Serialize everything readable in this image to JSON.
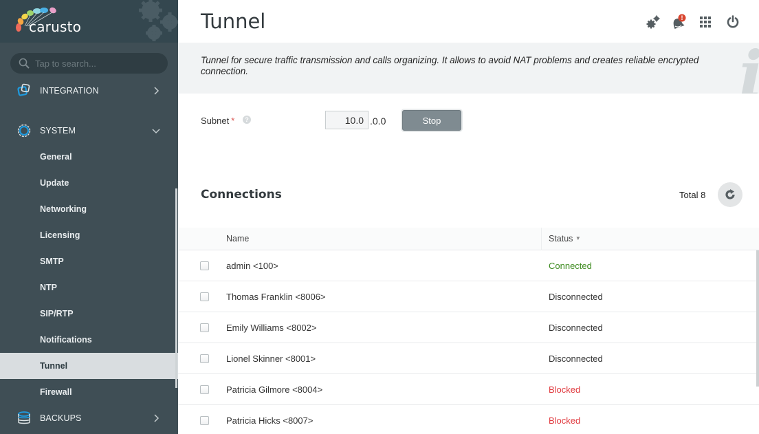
{
  "app": {
    "logo_text": "carusto"
  },
  "search": {
    "placeholder": "Tap to search..."
  },
  "sidebar": {
    "sections": [
      {
        "label": "INTEGRATION",
        "icon": "integration-icon",
        "expanded": false
      },
      {
        "label": "SYSTEM",
        "icon": "system-gear-icon",
        "expanded": true
      },
      {
        "label": "BACKUPS",
        "icon": "database-icon",
        "expanded": false
      }
    ],
    "system_items": [
      {
        "label": "General"
      },
      {
        "label": "Update"
      },
      {
        "label": "Networking"
      },
      {
        "label": "Licensing"
      },
      {
        "label": "SMTP"
      },
      {
        "label": "NTP"
      },
      {
        "label": "SIP/RTP"
      },
      {
        "label": "Notifications"
      },
      {
        "label": "Tunnel",
        "active": true
      },
      {
        "label": "Firewall"
      }
    ]
  },
  "header": {
    "title": "Tunnel",
    "icons": [
      "settings-gears-icon",
      "notification-bell-icon",
      "apps-grid-icon",
      "power-icon"
    ],
    "notification_badge": "!"
  },
  "info": {
    "text": "Tunnel for secure traffic transmission and calls organizing. It allows to avoid NAT problems and creates reliable encrypted connection.",
    "icon_glyph": "i"
  },
  "form": {
    "subnet_label": "Subnet",
    "required_mark": "*",
    "help_glyph": "?",
    "subnet_value": "10.0",
    "subnet_suffix": ".0.0",
    "stop_label": "Stop"
  },
  "connections": {
    "title": "Connections",
    "total_label": "Total 8",
    "columns": {
      "name": "Name",
      "status": "Status"
    },
    "rows": [
      {
        "name": "admin <100>",
        "status": "Connected",
        "status_color": "#3c8a1e"
      },
      {
        "name": "Thomas Franklin <8006>",
        "status": "Disconnected",
        "status_color": "#333333"
      },
      {
        "name": "Emily Williams <8002>",
        "status": "Disconnected",
        "status_color": "#333333"
      },
      {
        "name": "Lionel Skinner <8001>",
        "status": "Disconnected",
        "status_color": "#333333"
      },
      {
        "name": "Patricia Gilmore <8004>",
        "status": "Blocked",
        "status_color": "#e0393e"
      },
      {
        "name": "Patricia Hicks <8007>",
        "status": "Blocked",
        "status_color": "#e0393e"
      }
    ]
  },
  "colors": {
    "sidebar_bg": "#3f4e55",
    "accent_blue": "#1e9be0",
    "connected": "#3c8a1e",
    "blocked": "#e0393e",
    "badge_red": "#d9452f"
  }
}
